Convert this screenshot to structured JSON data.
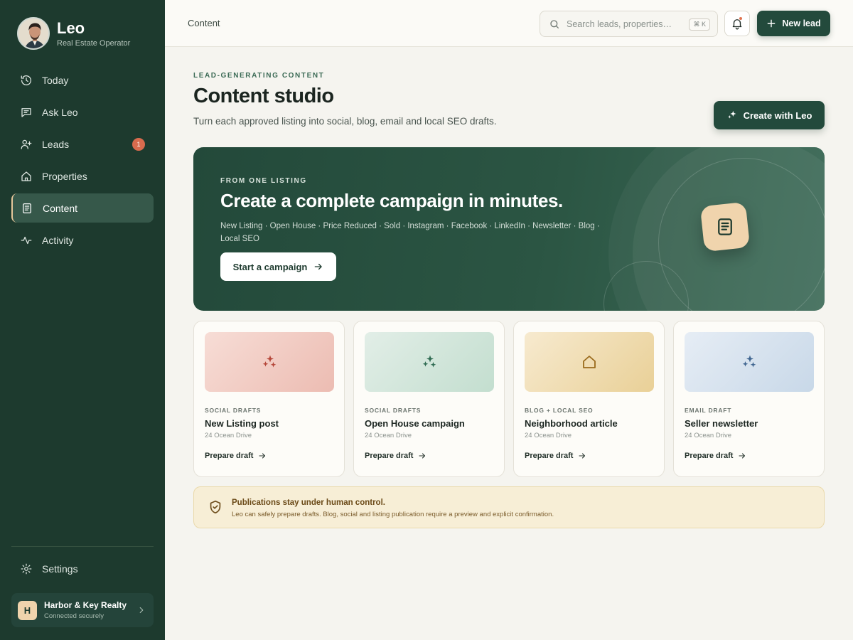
{
  "profile": {
    "name": "Leo",
    "role": "Real Estate Operator"
  },
  "nav": [
    {
      "label": "Today",
      "icon": "clock-history-icon"
    },
    {
      "label": "Ask Leo",
      "icon": "chat-icon"
    },
    {
      "label": "Leads",
      "icon": "user-plus-icon",
      "badge": "1"
    },
    {
      "label": "Properties",
      "icon": "house-icon"
    },
    {
      "label": "Content",
      "icon": "document-icon",
      "active": true
    },
    {
      "label": "Activity",
      "icon": "pulse-icon"
    }
  ],
  "settings": {
    "label": "Settings",
    "icon": "gear-icon"
  },
  "org": {
    "initial": "H",
    "name": "Harbor & Key Realty",
    "status": "Connected securely"
  },
  "header": {
    "breadcrumb": "Content",
    "search_placeholder": "Search leads, properties…",
    "search_shortcut": "⌘ K",
    "new_lead_label": "New lead"
  },
  "page": {
    "eyebrow": "LEAD-GENERATING CONTENT",
    "title": "Content studio",
    "subtitle": "Turn each approved listing into social, blog, email and local SEO drafts.",
    "create_label": "Create with Leo"
  },
  "hero": {
    "eyebrow": "FROM ONE LISTING",
    "title": "Create a complete campaign in minutes.",
    "tags": "New Listing · Open House · Price Reduced · Sold · Instagram · Facebook · LinkedIn · Newsletter · Blog · Local SEO",
    "cta_label": "Start a campaign"
  },
  "cards": [
    {
      "category": "SOCIAL DRAFTS",
      "title": "New Listing post",
      "address": "24 Ocean Drive",
      "cta": "Prepare draft",
      "icon": "sparkles-icon",
      "accent": "#b5473a"
    },
    {
      "category": "SOCIAL DRAFTS",
      "title": "Open House campaign",
      "address": "24 Ocean Drive",
      "cta": "Prepare draft",
      "icon": "sparkles-icon",
      "accent": "#2f6b52"
    },
    {
      "category": "BLOG + LOCAL SEO",
      "title": "Neighborhood article",
      "address": "24 Ocean Drive",
      "cta": "Prepare draft",
      "icon": "house-icon",
      "accent": "#9a6a1c"
    },
    {
      "category": "EMAIL DRAFT",
      "title": "Seller newsletter",
      "address": "24 Ocean Drive",
      "cta": "Prepare draft",
      "icon": "sparkles-icon",
      "accent": "#3f6590"
    }
  ],
  "notice": {
    "title": "Publications stay under human control.",
    "text": "Leo can safely prepare drafts. Blog, social and listing publication require a preview and explicit confirmation.",
    "icon": "shield-check-icon"
  },
  "colors": {
    "sidebar": "#1d3a2e",
    "primary": "#234a3c",
    "badge": "#d86b4e",
    "accent_gold": "#e7c79b"
  }
}
